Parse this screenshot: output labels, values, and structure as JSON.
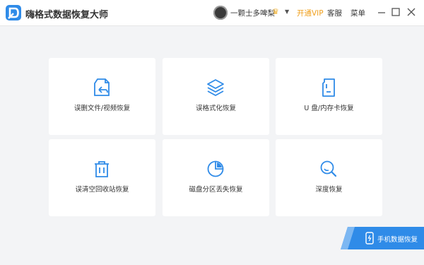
{
  "app": {
    "title": "嗨格式数据恢复大师",
    "logo_icon": "app-logo-icon"
  },
  "header": {
    "username": "一颗士多啤梨",
    "vip_label": "开通VIP",
    "service_label": "客服",
    "menu_label": "菜单"
  },
  "window_controls": [
    "minimize",
    "maximize",
    "close"
  ],
  "cards": [
    {
      "label": "误删文件/视频恢复",
      "icon": "file-restore-icon"
    },
    {
      "label": "误格式化恢复",
      "icon": "layers-icon"
    },
    {
      "label": "U 盘/内存卡恢复",
      "icon": "sd-card-icon"
    },
    {
      "label": "误清空回收站恢复",
      "icon": "trash-icon"
    },
    {
      "label": "磁盘分区丢失恢复",
      "icon": "pie-chart-icon"
    },
    {
      "label": "深度恢复",
      "icon": "search-icon"
    }
  ],
  "mobile_button": {
    "label": "手机数据恢复",
    "icon": "phone-icon"
  },
  "colors": {
    "accent": "#2f8be8",
    "vip": "#f0a01e",
    "background": "#f3f4f6",
    "card": "#ffffff"
  }
}
